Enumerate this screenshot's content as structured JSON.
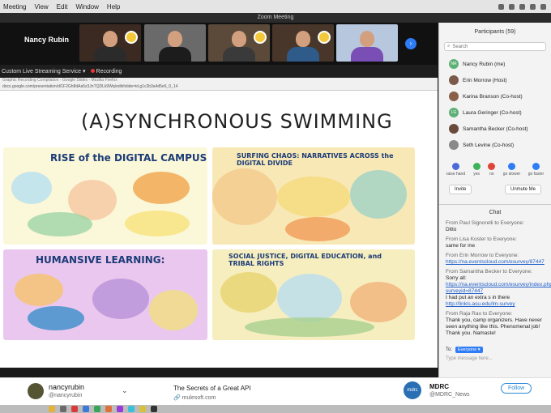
{
  "menubar": {
    "items": [
      "Meeting",
      "View",
      "Edit",
      "Window",
      "Help"
    ]
  },
  "window": {
    "title": "Zoom Meeting"
  },
  "video": {
    "active_speaker": "Nancy Rubin",
    "tiles": [
      {
        "bg": "#3b2a22",
        "shirt": "#2b2b2b"
      },
      {
        "bg": "#6a6a6a",
        "shirt": "#1c1c1c"
      },
      {
        "bg": "#5b4a3a",
        "shirt": "#3a3a3a"
      },
      {
        "bg": "#48362a",
        "shirt": "#2e5b8a"
      },
      {
        "bg": "#b7c7dd",
        "shirt": "#7a4fb5"
      }
    ]
  },
  "streambar": {
    "stream_label": "Custom Live Streaming Service",
    "recording_label": "Recording"
  },
  "share": {
    "tab_title": "Graphic Recording Compilation - Google Slides - Mozilla Firefox",
    "url": "docs.google.com/presentation/d/1F2Gh8dAa5z3JnTQDLk9Wq/edit#slide=id.g1c2b3a4d5e6_0_14",
    "slide_title": "(A)SYNCHRONOUS SWIMMING",
    "panels": [
      {
        "label": "RISE of the DIGITAL CAMPUS",
        "bg": "#fbf7d9"
      },
      {
        "label": "SURFING CHAOS: NARRATIVES ACROSS the DIGITAL DIVIDE",
        "bg": "#f8e8b6"
      },
      {
        "label": "HUMANSIVE LEARNING:",
        "bg": "#eac7ee"
      },
      {
        "label": "SOCIAL JUSTICE, DIGITAL EDUCATION, and TRIBAL RIGHTS",
        "bg": "#f6eebf"
      }
    ]
  },
  "participants": {
    "header": "Participants (59)",
    "search_placeholder": "Search",
    "people": [
      {
        "name": "Nancy Rubin (me)",
        "initials": "NR",
        "color": "#5db075"
      },
      {
        "name": "Erin Morrow (Host)",
        "initials": "",
        "color": "#7a5a4a"
      },
      {
        "name": "Karina Branson (Co-host)",
        "initials": "",
        "color": "#8a5f4a"
      },
      {
        "name": "Laura Geringer (Co-host)",
        "initials": "LG",
        "color": "#5db075"
      },
      {
        "name": "Samantha Becker (Co-host)",
        "initials": "",
        "color": "#6a4a3a"
      },
      {
        "name": "Seth Levine (Co-host)",
        "initials": "",
        "color": "#8a8a8a"
      }
    ],
    "controls": [
      {
        "label": "raise hand",
        "color": "#4a6ad8"
      },
      {
        "label": "yes",
        "color": "#3cb35a"
      },
      {
        "label": "no",
        "color": "#e0453a"
      },
      {
        "label": "go slower",
        "color": "#2e7cf6"
      },
      {
        "label": "go faster",
        "color": "#2e7cf6"
      }
    ],
    "invite_label": "Invite",
    "unmute_label": "Unmute Me"
  },
  "chat": {
    "header": "Chat",
    "messages": [
      {
        "from": "From Paul Signorelli to Everyone:",
        "text": "Ditto",
        "link": ""
      },
      {
        "from": "From Lisa Koster to Everyone:",
        "text": "same for me",
        "link": ""
      },
      {
        "from": "From Erin Morrow to Everyone:",
        "text": "",
        "link": "https://na.eventscloud.com/esurvey/87447"
      },
      {
        "from": "From Samantha Becker to Everyone:",
        "text": "Sorry all:",
        "link": "https://na.eventscloud.com/esurvey/index.php?surveyid=87447",
        "text2": "I had put an extra s in there",
        "link2": "http://linkis.asu.edu/lm-survey"
      },
      {
        "from": "From Raja Rao to Everyone:",
        "text": "Thank you, camp organizers. Have never seen anything like this. Phenomenal job! Thank you. Namaste!",
        "link": ""
      }
    ],
    "to_label": "To:",
    "to_value": "Everyone",
    "input_placeholder": "Type message here..."
  },
  "twitter": {
    "user_name": "nancyrubin",
    "user_handle": "@nancyrubin",
    "ad_title": "The Secrets of a Great API",
    "ad_source": "mulesoft.com",
    "org_logo": "mdrc",
    "org_name": "MDRC",
    "org_handle": "@MDRC_News",
    "follow_label": "Follow"
  }
}
